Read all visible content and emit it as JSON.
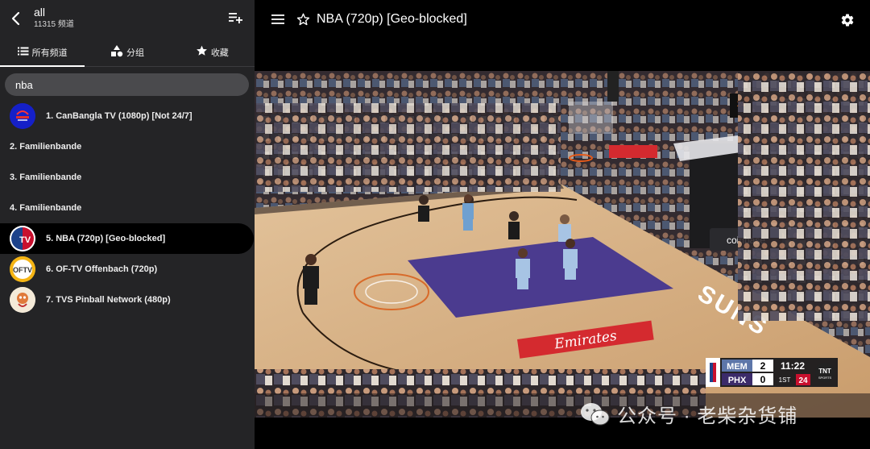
{
  "sidebar": {
    "title": "all",
    "subtitle": "11315 频道",
    "tabs": [
      {
        "label": "所有频道",
        "icon": "list-icon"
      },
      {
        "label": "分组",
        "icon": "category-shapes-icon"
      },
      {
        "label": "收藏",
        "icon": "star-icon"
      }
    ],
    "search": {
      "value": "nba",
      "placeholder": ""
    },
    "channels": [
      {
        "label": "1. CanBangla TV (1080p) [Not 24/7]",
        "logo": "canbangla-logo"
      },
      {
        "label": "2. Familienbande",
        "logo": ""
      },
      {
        "label": "3. Familienbande",
        "logo": ""
      },
      {
        "label": "4. Familienbande",
        "logo": ""
      },
      {
        "label": "5. NBA (720p) [Geo-blocked]",
        "logo": "nba-tv-logo",
        "logo_text": "TV",
        "selected": true
      },
      {
        "label": "6. OF-TV Offenbach (720p)",
        "logo": "of-tv-logo",
        "logo_text": "OFTV"
      },
      {
        "label": "7. TVS Pinball Network (480p)",
        "logo": "tvs-pinball-logo"
      }
    ]
  },
  "player": {
    "title": "NBA (720p) [Geo-blocked]"
  },
  "scorebug": {
    "team1": "MEM",
    "score1": "2",
    "team2": "PHX",
    "score2": "0",
    "clock": "11:22",
    "period": "1ST",
    "shot_clock": "24",
    "network": "TNT"
  },
  "arena": {
    "sponsor_floor": "Emirates",
    "sponsor_board": "coinbase"
  },
  "watermark": "公众号 · 老柴杂货铺",
  "colors": {
    "sidebar_bg": "#242426",
    "selected_bg": "#000000",
    "court_wood": "#d8b48a",
    "paint_purple": "#4b3b8f",
    "emirates_red": "#d42a2f"
  }
}
